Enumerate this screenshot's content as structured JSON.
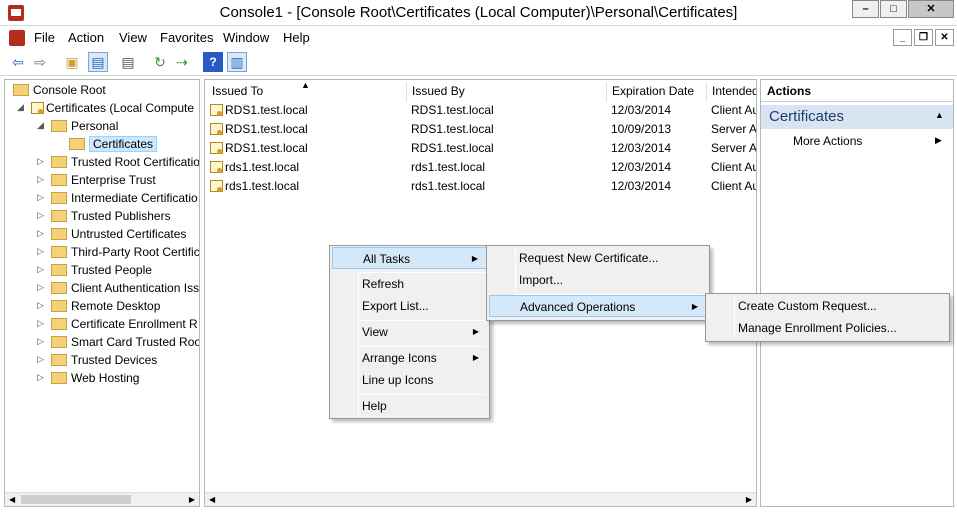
{
  "window": {
    "title": "Console1 - [Console Root\\Certificates (Local Computer)\\Personal\\Certificates]",
    "min": "–",
    "max": "□",
    "close": "✕",
    "mdi_min": "_",
    "mdi_restore": "❐",
    "mdi_close": "✕"
  },
  "menubar": [
    "File",
    "Action",
    "View",
    "Favorites",
    "Window",
    "Help"
  ],
  "toolbar_icons": [
    "back-icon",
    "forward-icon",
    "up-folder-icon",
    "show-hide-tree-icon",
    "properties-icon",
    "refresh-icon",
    "export-icon",
    "help-icon",
    "show-hide-action-pane-icon"
  ],
  "tree": {
    "root": "Console Root",
    "certificates": "Certificates (Local Compute",
    "personal": "Personal",
    "selected": "Certificates",
    "stores": [
      "Trusted Root Certificatio",
      "Enterprise Trust",
      "Intermediate Certificatio",
      "Trusted Publishers",
      "Untrusted Certificates",
      "Third-Party Root Certific",
      "Trusted People",
      "Client Authentication Iss",
      "Remote Desktop",
      "Certificate Enrollment R",
      "Smart Card Trusted Roo",
      "Trusted Devices",
      "Web Hosting"
    ]
  },
  "list": {
    "headers": [
      "Issued To",
      "Issued By",
      "Expiration Date",
      "Intended"
    ],
    "rows": [
      [
        "RDS1.test.local",
        "RDS1.test.local",
        "12/03/2014",
        "Client Au"
      ],
      [
        "RDS1.test.local",
        "RDS1.test.local",
        "10/09/2013",
        "Server A"
      ],
      [
        "RDS1.test.local",
        "RDS1.test.local",
        "12/03/2014",
        "Server A"
      ],
      [
        "rds1.test.local",
        "rds1.test.local",
        "12/03/2014",
        "Client Au"
      ],
      [
        "rds1.test.local",
        "rds1.test.local",
        "12/03/2014",
        "Client Au"
      ]
    ]
  },
  "actions": {
    "header": "Actions",
    "section": "Certificates",
    "more": "More Actions"
  },
  "context_menu": {
    "all_tasks": "All Tasks",
    "refresh": "Refresh",
    "export": "Export List...",
    "view": "View",
    "arrange": "Arrange Icons",
    "lineup": "Line up Icons",
    "help": "Help"
  },
  "submenu1": {
    "request": "Request New Certificate...",
    "import": "Import...",
    "advanced": "Advanced Operations"
  },
  "submenu2": {
    "custom": "Create Custom Request...",
    "policies": "Manage Enrollment Policies..."
  },
  "colors": {
    "selection": "#cce8ff",
    "actions_section": "#d8e4f2",
    "highlight": "#d5e8f8"
  }
}
